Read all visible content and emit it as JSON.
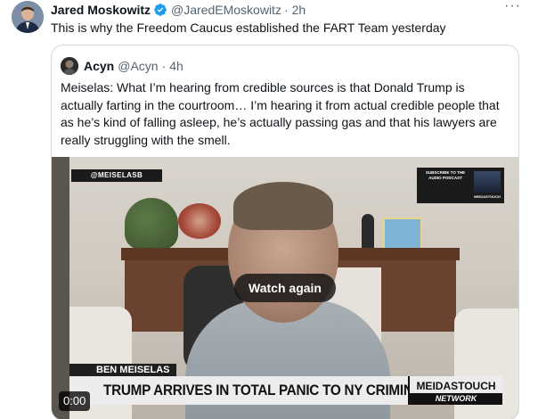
{
  "tweet": {
    "author_name": "Jared Moskowitz",
    "author_handle": "@JaredEMoskowitz",
    "separator": "·",
    "time": "2h",
    "text": "This is why the Freedom Caucus established the FART Team yesterday",
    "more_label": "···"
  },
  "quote": {
    "author_name": "Acyn",
    "author_handle": "@Acyn",
    "separator": "·",
    "time": "4h",
    "text": "Meiselas: What I’m hearing from credible sources is that Donald Trump is actually farting in the courtroom… I’m hearing it from actual credible people that as he’s kind of falling asleep, he’s actually passing gas and that his lawyers are really struggling with the smell."
  },
  "video": {
    "corner_tag": "@MEISELASB",
    "promo_text": "SUBSCRIBE TO THE AUDIO PODCAST",
    "promo_logo": "MEIDASTOUCH",
    "watch_again_label": "Watch again",
    "lower_third_name": "BEN MEISELAS",
    "lower_third_headline": "TRUMP ARRIVES IN TOTAL PANIC TO NY CRIMINAL TRIAL",
    "brand_top": "MEIDASTOUCH",
    "brand_bottom": "NETWORK",
    "timestamp": "0:00"
  },
  "colors": {
    "verified_blue": "#1d9bf0",
    "secondary_text": "#536471",
    "border": "#cfd9de"
  }
}
